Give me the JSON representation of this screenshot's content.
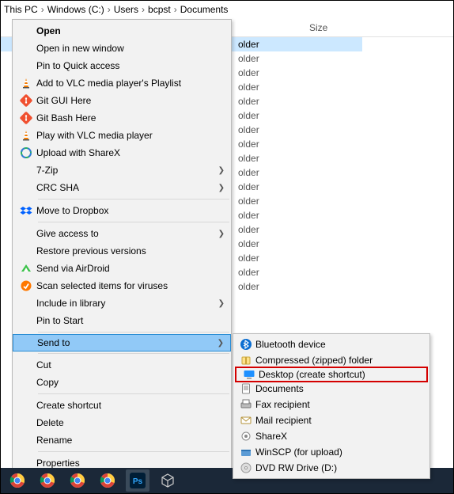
{
  "breadcrumb": {
    "items": [
      "This PC",
      "Windows (C:)",
      "Users",
      "bcpst",
      "Documents"
    ]
  },
  "columns": {
    "size": "Size"
  },
  "file_type_visible": "older",
  "context_menu": {
    "groups": [
      {
        "items": [
          {
            "label": "Open",
            "bold": true,
            "icon": null,
            "arrow": false
          },
          {
            "label": "Open in new window",
            "icon": null,
            "arrow": false
          },
          {
            "label": "Pin to Quick access",
            "icon": null,
            "arrow": false
          },
          {
            "label": "Add to VLC media player's Playlist",
            "icon": "vlc",
            "arrow": false
          },
          {
            "label": "Git GUI Here",
            "icon": "git",
            "arrow": false
          },
          {
            "label": "Git Bash Here",
            "icon": "git",
            "arrow": false
          },
          {
            "label": "Play with VLC media player",
            "icon": "vlc",
            "arrow": false
          },
          {
            "label": "Upload with ShareX",
            "icon": "sharex",
            "arrow": false
          },
          {
            "label": "7-Zip",
            "icon": null,
            "arrow": true
          },
          {
            "label": "CRC SHA",
            "icon": null,
            "arrow": true
          }
        ]
      },
      {
        "items": [
          {
            "label": "Move to Dropbox",
            "icon": "dropbox",
            "arrow": false
          }
        ]
      },
      {
        "items": [
          {
            "label": "Give access to",
            "icon": null,
            "arrow": true
          },
          {
            "label": "Restore previous versions",
            "icon": null,
            "arrow": false
          },
          {
            "label": "Send via AirDroid",
            "icon": "airdroid",
            "arrow": false
          },
          {
            "label": "Scan selected items for viruses",
            "icon": "avast",
            "arrow": false
          },
          {
            "label": "Include in library",
            "icon": null,
            "arrow": true
          },
          {
            "label": "Pin to Start",
            "icon": null,
            "arrow": false
          }
        ]
      },
      {
        "items": [
          {
            "label": "Send to",
            "icon": null,
            "arrow": true,
            "highlight": true
          }
        ]
      },
      {
        "items": [
          {
            "label": "Cut",
            "icon": null,
            "arrow": false
          },
          {
            "label": "Copy",
            "icon": null,
            "arrow": false
          }
        ]
      },
      {
        "items": [
          {
            "label": "Create shortcut",
            "icon": null,
            "arrow": false
          },
          {
            "label": "Delete",
            "icon": null,
            "arrow": false
          },
          {
            "label": "Rename",
            "icon": null,
            "arrow": false
          }
        ]
      },
      {
        "items": [
          {
            "label": "Properties",
            "icon": null,
            "arrow": false
          }
        ]
      }
    ]
  },
  "submenu": {
    "items": [
      {
        "label": "Bluetooth device",
        "icon": "bluetooth",
        "red": false
      },
      {
        "label": "Compressed (zipped) folder",
        "icon": "zip",
        "red": false
      },
      {
        "label": "Desktop (create shortcut)",
        "icon": "desktop",
        "red": true
      },
      {
        "label": "Documents",
        "icon": "docs",
        "red": false
      },
      {
        "label": "Fax recipient",
        "icon": "fax",
        "red": false
      },
      {
        "label": "Mail recipient",
        "icon": "mail",
        "red": false
      },
      {
        "label": "ShareX",
        "icon": "sharexg",
        "red": false
      },
      {
        "label": "WinSCP (for upload)",
        "icon": "winscp",
        "red": false
      },
      {
        "label": "DVD RW Drive (D:)",
        "icon": "disc",
        "red": false
      }
    ]
  },
  "taskbar": {
    "icons": [
      "chrome",
      "chrome",
      "chrome",
      "chrome",
      "photoshop",
      "cube"
    ]
  }
}
